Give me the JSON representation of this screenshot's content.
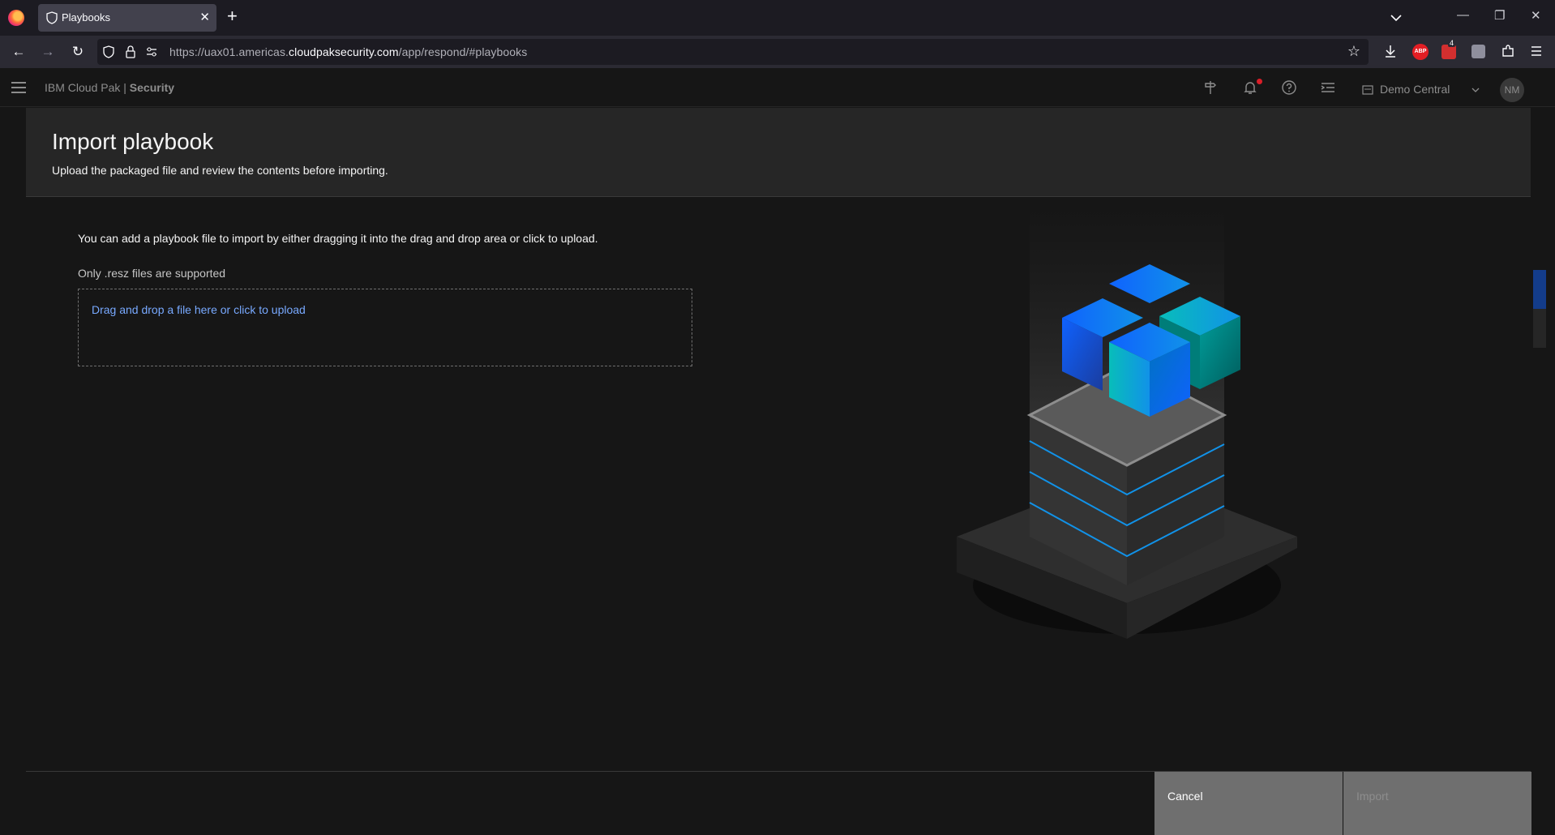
{
  "browser": {
    "tab_title": "Playbooks",
    "url_prefix": "https://uax01.americas.",
    "url_host": "cloudpaksecurity.com",
    "url_path": "/app/respond/#playbooks",
    "adblock_label": "ABP",
    "ext_badge": "4"
  },
  "app": {
    "product_name": "IBM Cloud Pak | ",
    "product_suffix": "Security",
    "tenant": "Demo Central",
    "avatar_initials": "NM"
  },
  "modal": {
    "title": "Import playbook",
    "subtitle": "Upload the packaged file and review the contents before importing.",
    "instructions": "You can add a playbook file to import by either dragging it into the drag and drop area or click to upload.",
    "supported_note": "Only .resz files are supported",
    "dropzone_text": "Drag and drop a file here or click to upload",
    "cancel_label": "Cancel",
    "import_label": "Import"
  },
  "colors": {
    "accent": "#0f62fe",
    "link": "#78a9ff",
    "background": "#161616"
  }
}
